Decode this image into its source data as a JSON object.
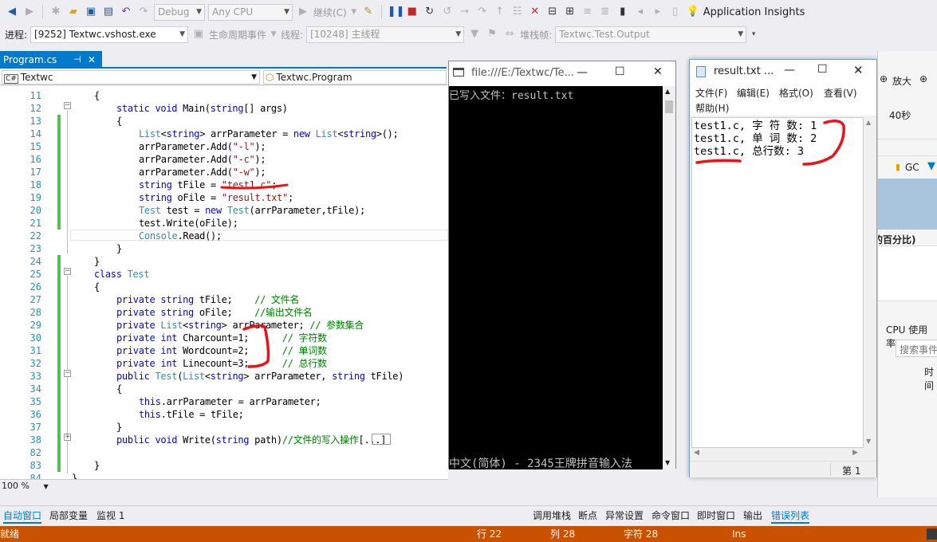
{
  "toolbar": {
    "config": "Debug",
    "platform": "Any CPU",
    "continue_label": "继续(C)",
    "insights": "Application Insights"
  },
  "toolbar2": {
    "process_label": "进程:",
    "process_value": "[9252] Textwc.vshost.exe",
    "lifecycle_label": "生命周期事件",
    "thread_label": "线程:",
    "thread_value": "[10248] 主线程",
    "stack_label": "堆栈帧:",
    "stack_value": "Textwc.Test.Output"
  },
  "editor": {
    "tab_label": "Program.cs",
    "nav_left": "Textwc",
    "nav_right": "Textwc.Program",
    "zoom": "100 %",
    "lines": [
      {
        "n": "11",
        "segs": [
          [
            "p",
            "{"
          ]
        ],
        "indent": 1
      },
      {
        "n": "12",
        "segs": [
          [
            "kw",
            "static "
          ],
          [
            "kw",
            "void "
          ],
          [
            "p",
            "Main("
          ],
          [
            "kw",
            "string"
          ],
          [
            "p",
            "[] args)"
          ]
        ],
        "indent": 2
      },
      {
        "n": "13",
        "segs": [
          [
            "p",
            "{"
          ]
        ],
        "indent": 2
      },
      {
        "n": "14",
        "segs": [
          [
            "ty",
            "List"
          ],
          [
            "p",
            "<"
          ],
          [
            "kw",
            "string"
          ],
          [
            "p",
            "> arrParameter = "
          ],
          [
            "kw",
            "new "
          ],
          [
            "ty",
            "List"
          ],
          [
            "p",
            "<"
          ],
          [
            "kw",
            "string"
          ],
          [
            "p",
            ">();"
          ]
        ],
        "indent": 3
      },
      {
        "n": "15",
        "segs": [
          [
            "p",
            "arrParameter.Add("
          ],
          [
            "st",
            "\"-l\""
          ],
          [
            "p",
            ");"
          ]
        ],
        "indent": 3
      },
      {
        "n": "16",
        "segs": [
          [
            "p",
            "arrParameter.Add("
          ],
          [
            "st",
            "\"-c\""
          ],
          [
            "p",
            ");"
          ]
        ],
        "indent": 3
      },
      {
        "n": "17",
        "segs": [
          [
            "p",
            "arrParameter.Add("
          ],
          [
            "st",
            "\"-w\""
          ],
          [
            "p",
            ");"
          ]
        ],
        "indent": 3
      },
      {
        "n": "18",
        "segs": [
          [
            "kw",
            "string "
          ],
          [
            "p",
            "tFile = "
          ],
          [
            "st",
            "\"test1.c\""
          ],
          [
            "p",
            ";"
          ]
        ],
        "indent": 3
      },
      {
        "n": "19",
        "segs": [
          [
            "kw",
            "string "
          ],
          [
            "p",
            "oFile = "
          ],
          [
            "st",
            "\"result.txt\""
          ],
          [
            "p",
            ";"
          ]
        ],
        "indent": 3
      },
      {
        "n": "20",
        "segs": [
          [
            "ty",
            "Test "
          ],
          [
            "p",
            "test = "
          ],
          [
            "kw",
            "new "
          ],
          [
            "ty",
            "Test"
          ],
          [
            "p",
            "(arrParameter,tFile);"
          ]
        ],
        "indent": 3
      },
      {
        "n": "21",
        "segs": [
          [
            "p",
            "test.Write(oFile);"
          ]
        ],
        "indent": 3
      },
      {
        "n": "22",
        "segs": [
          [
            "ty",
            "Console"
          ],
          [
            "p",
            ".Read();"
          ]
        ],
        "indent": 3
      },
      {
        "n": "23",
        "segs": [
          [
            "p",
            "}"
          ]
        ],
        "indent": 2
      },
      {
        "n": "24",
        "segs": [
          [
            "p",
            "}"
          ]
        ],
        "indent": 1
      },
      {
        "n": "25",
        "segs": [
          [
            "kw",
            "class "
          ],
          [
            "ty",
            "Test"
          ]
        ],
        "indent": 1
      },
      {
        "n": "26",
        "segs": [
          [
            "p",
            "{"
          ]
        ],
        "indent": 1
      },
      {
        "n": "27",
        "segs": [
          [
            "kw",
            "private "
          ],
          [
            "kw",
            "string "
          ],
          [
            "p",
            "tFile;    "
          ],
          [
            "cm",
            "// 文件名"
          ]
        ],
        "indent": 2
      },
      {
        "n": "28",
        "segs": [
          [
            "kw",
            "private "
          ],
          [
            "kw",
            "string "
          ],
          [
            "p",
            "oFile;    "
          ],
          [
            "cm",
            "//输出文件名"
          ]
        ],
        "indent": 2
      },
      {
        "n": "29",
        "segs": [
          [
            "kw",
            "private "
          ],
          [
            "ty",
            "List"
          ],
          [
            "p",
            "<"
          ],
          [
            "kw",
            "string"
          ],
          [
            "p",
            "> arrParameter; "
          ],
          [
            "cm",
            "// 参数集合"
          ]
        ],
        "indent": 2
      },
      {
        "n": "30",
        "segs": [
          [
            "kw",
            "private "
          ],
          [
            "kw",
            "int "
          ],
          [
            "p",
            "Charcount=1;      "
          ],
          [
            "cm",
            "// 字符数"
          ]
        ],
        "indent": 2
      },
      {
        "n": "31",
        "segs": [
          [
            "kw",
            "private "
          ],
          [
            "kw",
            "int "
          ],
          [
            "p",
            "Wordcount=2;      "
          ],
          [
            "cm",
            "// 单词数"
          ]
        ],
        "indent": 2
      },
      {
        "n": "32",
        "segs": [
          [
            "kw",
            "private "
          ],
          [
            "kw",
            "int "
          ],
          [
            "p",
            "Linecount=3;      "
          ],
          [
            "cm",
            "// 总行数"
          ]
        ],
        "indent": 2
      },
      {
        "n": "33",
        "segs": [
          [
            "kw",
            "public "
          ],
          [
            "ty",
            "Test"
          ],
          [
            "p",
            "("
          ],
          [
            "ty",
            "List"
          ],
          [
            "p",
            "<"
          ],
          [
            "kw",
            "string"
          ],
          [
            "p",
            "> arrParameter, "
          ],
          [
            "kw",
            "string "
          ],
          [
            "p",
            "tFile)"
          ]
        ],
        "indent": 2
      },
      {
        "n": "34",
        "segs": [
          [
            "p",
            "{"
          ]
        ],
        "indent": 2
      },
      {
        "n": "35",
        "segs": [
          [
            "kw",
            "this"
          ],
          [
            "p",
            ".arrParameter = arrParameter;"
          ]
        ],
        "indent": 3
      },
      {
        "n": "36",
        "segs": [
          [
            "kw",
            "this"
          ],
          [
            "p",
            ".tFile = tFile;"
          ]
        ],
        "indent": 3
      },
      {
        "n": "37",
        "segs": [
          [
            "p",
            "}"
          ]
        ],
        "indent": 2
      },
      {
        "n": "38",
        "segs": [
          [
            "kw",
            "public "
          ],
          [
            "kw",
            "void "
          ],
          [
            "p",
            "Write("
          ],
          [
            "kw",
            "string "
          ],
          [
            "p",
            "path)"
          ],
          [
            "cm",
            "//文件的写入操作"
          ],
          [
            "p",
            "[...]"
          ]
        ],
        "indent": 2
      },
      {
        "n": "82",
        "segs": [],
        "indent": 0
      },
      {
        "n": "83",
        "segs": [
          [
            "p",
            "}"
          ]
        ],
        "indent": 1
      },
      {
        "n": "84",
        "segs": [
          [
            "p",
            "}"
          ]
        ],
        "indent": 0
      }
    ]
  },
  "console": {
    "title": "file:///E:/Textwc/Te...",
    "output": "已写入文件：result.txt",
    "ime": "中文(简体) - 2345王牌拼音输入法"
  },
  "notepad": {
    "title": "result.txt ...",
    "menu": [
      "文件(F)",
      "编辑(E)",
      "格式(O)",
      "查看(V)",
      "帮助(H)"
    ],
    "lines": [
      "test1.c, 字 符 数: 1",
      "test1.c, 单 词 数: 2",
      "test1.c, 总行数: 3"
    ],
    "status": "第 1"
  },
  "rightpanel": {
    "zoom_in": "放大",
    "seconds": "40秒",
    "gc": "GC",
    "percent": "的百分比)",
    "cpu": "CPU 使用率",
    "search": "搜索事件",
    "time": "时间"
  },
  "bottom_tabs": {
    "left": [
      "自动窗口",
      "局部变量",
      "监视 1"
    ],
    "right": [
      "调用堆栈",
      "断点",
      "异常设置",
      "命令窗口",
      "即时窗口",
      "输出",
      "错误列表"
    ]
  },
  "status": {
    "ready": "就绪",
    "row": "行 22",
    "col": "列 28",
    "ch": "字符 28",
    "ins": "Ins"
  }
}
